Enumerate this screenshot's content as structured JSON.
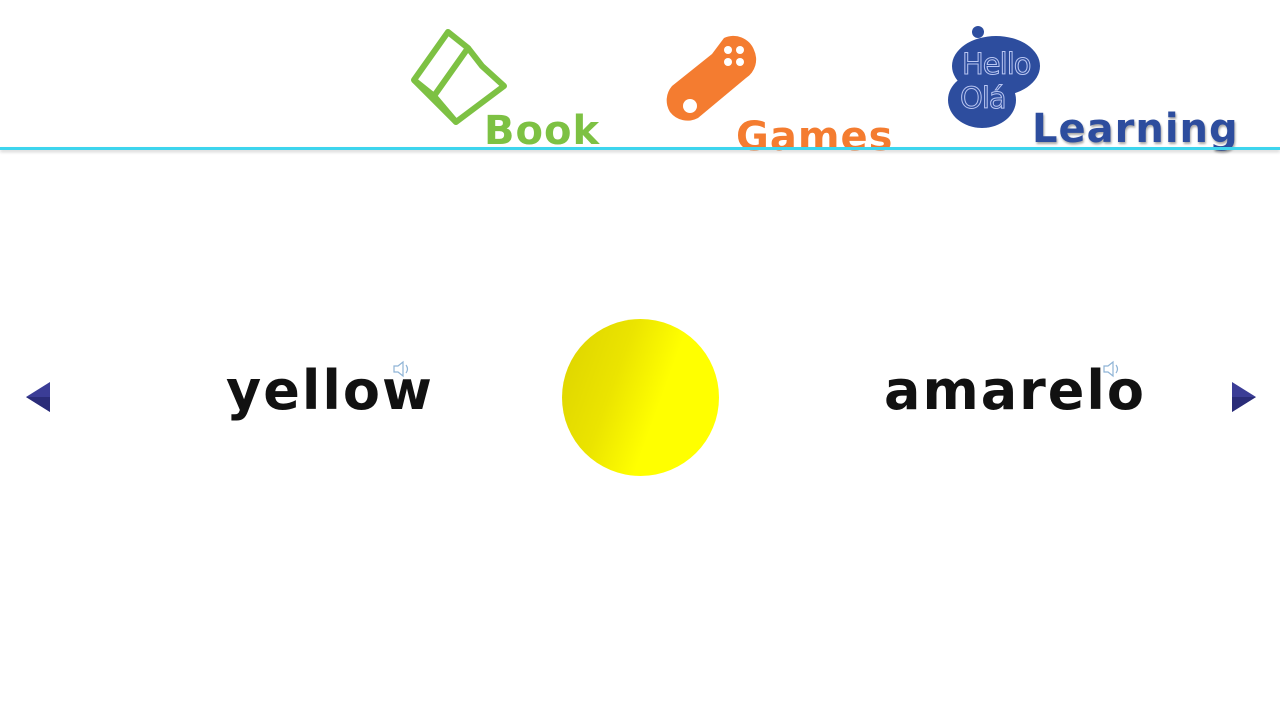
{
  "nav": {
    "book": {
      "label": "Book",
      "icon": "book-icon",
      "color": "#7dc143"
    },
    "games": {
      "label": "Games",
      "icon": "gamepad-icon",
      "color": "#f47c30"
    },
    "learning": {
      "label": "Learning",
      "icon": "hello-ola-logo",
      "logo_line1": "Hello",
      "logo_line2": "Olá",
      "color": "#2d4d9e"
    }
  },
  "accent_line_color": "#3dd5ee",
  "flashcard": {
    "english_word": "yellow",
    "portuguese_word": "amarelo",
    "swatch_color": "#ffff00",
    "speaker_icon": "speaker-icon"
  },
  "controls": {
    "prev_icon": "triangle-left-icon",
    "next_icon": "triangle-right-icon",
    "arrow_color": "#3b3d96"
  }
}
